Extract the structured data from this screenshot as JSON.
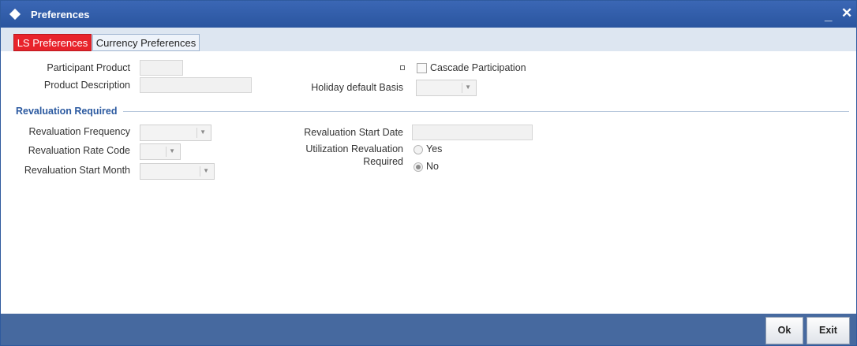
{
  "window": {
    "title": "Preferences",
    "minimize_glyph": "_",
    "close_glyph": "✕"
  },
  "tabs": [
    {
      "label": "LS Preferences",
      "active": true
    },
    {
      "label": "Currency Preferences",
      "active": false
    }
  ],
  "fields": {
    "participant_product": {
      "label": "Participant Product",
      "value": ""
    },
    "product_description": {
      "label": "Product Description",
      "value": ""
    },
    "cascade_participation": {
      "label": "Cascade Participation",
      "checked": false
    },
    "holiday_default_basis": {
      "label": "Holiday default Basis",
      "value": ""
    }
  },
  "revaluation": {
    "section_title": "Revaluation Required",
    "frequency": {
      "label": "Revaluation Frequency",
      "value": ""
    },
    "rate_code": {
      "label": "Revaluation Rate Code",
      "value": ""
    },
    "start_month": {
      "label": "Revaluation Start Month",
      "value": ""
    },
    "start_date": {
      "label": "Revaluation Start Date",
      "value": ""
    },
    "utilization": {
      "label_line1": "Utilization Revaluation",
      "label_line2": "Required",
      "options": [
        {
          "label": "Yes",
          "checked": false
        },
        {
          "label": "No",
          "checked": true
        }
      ]
    }
  },
  "buttons": {
    "ok": "Ok",
    "exit": "Exit"
  },
  "colors": {
    "titlebar": "#2a559f",
    "active_tab": "#e8232b",
    "footer": "#46699f",
    "section_title": "#2c5aa0"
  }
}
